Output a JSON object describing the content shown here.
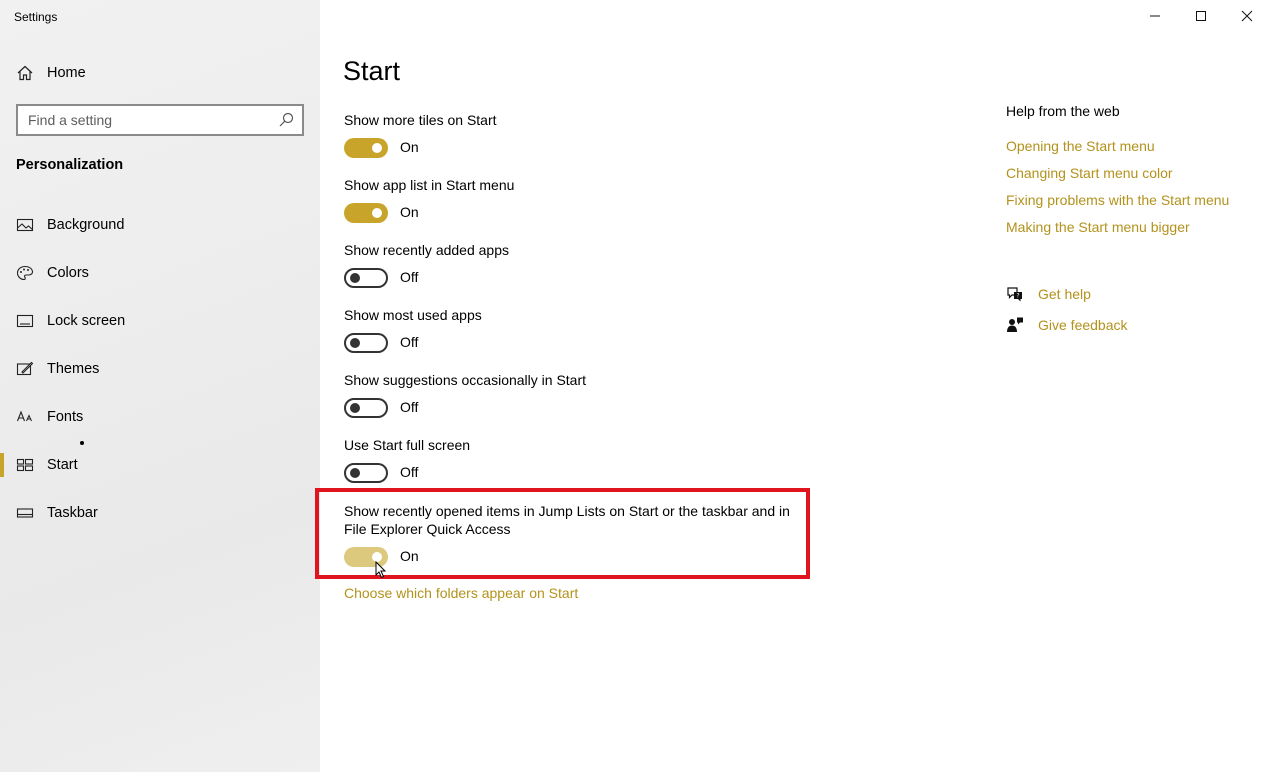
{
  "window": {
    "title": "Settings"
  },
  "sidebar": {
    "home_label": "Home",
    "search_placeholder": "Find a setting",
    "section_title": "Personalization",
    "items": [
      {
        "label": "Background",
        "icon": "image-icon"
      },
      {
        "label": "Colors",
        "icon": "palette-icon"
      },
      {
        "label": "Lock screen",
        "icon": "lock-screen-icon"
      },
      {
        "label": "Themes",
        "icon": "themes-icon"
      },
      {
        "label": "Fonts",
        "icon": "fonts-icon"
      },
      {
        "label": "Start",
        "icon": "start-icon",
        "selected": true
      },
      {
        "label": "Taskbar",
        "icon": "taskbar-icon"
      }
    ]
  },
  "main": {
    "title": "Start",
    "settings": [
      {
        "label": "Show more tiles on Start",
        "state": "On",
        "on": true
      },
      {
        "label": "Show app list in Start menu",
        "state": "On",
        "on": true
      },
      {
        "label": "Show recently added apps",
        "state": "Off",
        "on": false
      },
      {
        "label": "Show most used apps",
        "state": "Off",
        "on": false
      },
      {
        "label": "Show suggestions occasionally in Start",
        "state": "Off",
        "on": false
      },
      {
        "label": "Use Start full screen",
        "state": "Off",
        "on": false
      },
      {
        "label_line1": "Show recently opened items in Jump Lists on Start or the taskbar and in",
        "label_line2": "File Explorer Quick Access",
        "state": "On",
        "on": true
      }
    ],
    "folders_link": "Choose which folders appear on Start"
  },
  "help": {
    "title": "Help from the web",
    "links": [
      "Opening the Start menu",
      "Changing Start menu color",
      "Fixing problems with the Start menu",
      "Making the Start menu bigger"
    ],
    "get_help": "Get help",
    "give_feedback": "Give feedback"
  },
  "colors": {
    "accent": "#c8a52a",
    "link": "#b3921c",
    "highlight": "#e0141e"
  }
}
